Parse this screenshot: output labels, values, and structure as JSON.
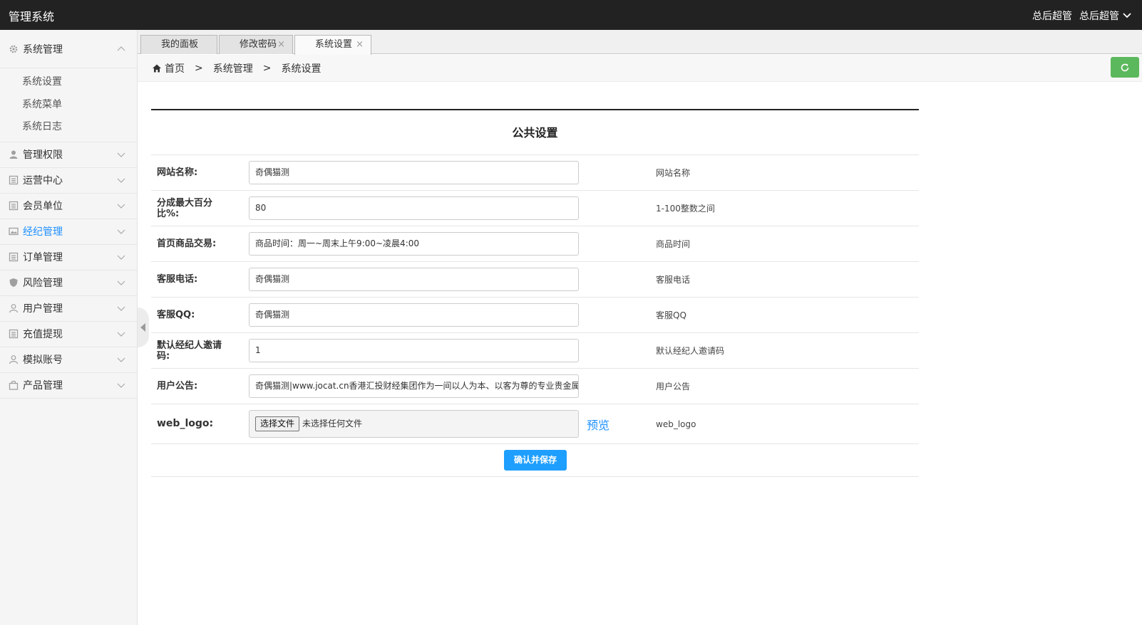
{
  "app": {
    "title": "管理系统"
  },
  "topbar": {
    "user1": "总后超管",
    "user2": "总后超管"
  },
  "sidebar": {
    "items": [
      {
        "label": "系统管理",
        "icon": "gear-icon",
        "expanded": true,
        "children": [
          "系统设置",
          "系统菜单",
          "系统日志"
        ]
      },
      {
        "label": "管理权限",
        "icon": "user-icon"
      },
      {
        "label": "运营中心",
        "icon": "list-icon"
      },
      {
        "label": "会员单位",
        "icon": "list-icon"
      },
      {
        "label": "经纪管理",
        "icon": "image-icon",
        "active": true
      },
      {
        "label": "订单管理",
        "icon": "list-icon"
      },
      {
        "label": "风险管理",
        "icon": "shield-icon"
      },
      {
        "label": "用户管理",
        "icon": "user-icon"
      },
      {
        "label": "充值提现",
        "icon": "list-icon"
      },
      {
        "label": "模拟账号",
        "icon": "user-icon"
      },
      {
        "label": "产品管理",
        "icon": "bag-icon"
      }
    ]
  },
  "tabs": [
    {
      "label": "我的面板"
    },
    {
      "label": "修改密码"
    },
    {
      "label": "系统设置"
    }
  ],
  "breadcrumb": {
    "home": "首页",
    "level1": "系统管理",
    "level2": "系统设置",
    "sep": ">"
  },
  "form": {
    "section_title": "公共设置",
    "rows": [
      {
        "label": "网站名称:",
        "value": "奇偶猫测",
        "hint": "网站名称"
      },
      {
        "label": "分成最大百分比%:",
        "value": "80",
        "hint": "1-100整数之间"
      },
      {
        "label": "首页商品交易:",
        "value": "商品时间：周一~周末上午9:00~凌晨4:00",
        "hint": "商品时间"
      },
      {
        "label": "客服电话:",
        "value": "奇偶猫测",
        "hint": "客服电话"
      },
      {
        "label": "客服QQ:",
        "value": "奇偶猫测",
        "hint": "客服QQ"
      },
      {
        "label": "默认经纪人邀请码:",
        "value": "1",
        "hint": "默认经纪人邀请码"
      },
      {
        "label": "用户公告:",
        "value": "奇偶猫测|www.jocat.cn香港汇投财经集团作为一间以人为本、以客为尊的专业贵金属经",
        "hint": "用户公告"
      }
    ],
    "file_row": {
      "label": "web_logo:",
      "button": "选择文件",
      "status": "未选择任何文件",
      "preview": "预览",
      "hint": "web_logo"
    },
    "save_label": "确认并保存"
  },
  "colors": {
    "topbar": "#222222",
    "accent": "#1e9fff",
    "refresh": "#5cb85c",
    "active_menu": "#1e90ff"
  }
}
